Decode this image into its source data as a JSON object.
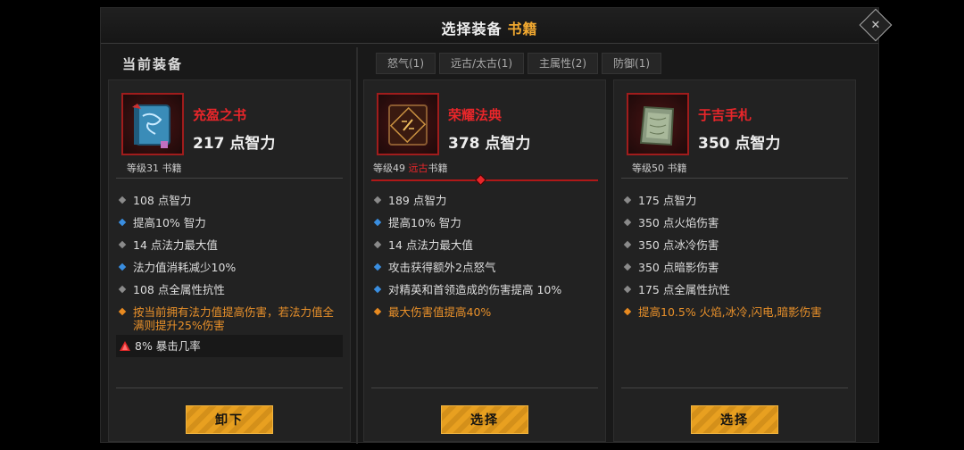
{
  "header": {
    "title": "选择装备",
    "title_accent": "书籍"
  },
  "left_header": "当前装备",
  "tabs": [
    "怒气(1)",
    "远古/太古(1)",
    "主属性(2)",
    "防御(1)"
  ],
  "cards": [
    {
      "name": "充盈之书",
      "main_stat": "217 点智力",
      "meta_prefix": "等级31",
      "meta_rarity": "",
      "meta_suffix": " 书籍",
      "stats": [
        {
          "text": "108 点智力",
          "dot": "grey"
        },
        {
          "text": "提高10% 智力",
          "dot": "blue"
        },
        {
          "text": "14 点法力最大值",
          "dot": "grey"
        },
        {
          "text": "法力值消耗减少10%",
          "dot": "blue"
        },
        {
          "text": "108 点全属性抗性",
          "dot": "grey"
        },
        {
          "text": "按当前拥有法力值提高伤害，若法力值全满则提升25%伤害",
          "dot": "orange"
        }
      ],
      "crit": "8% 暴击几率",
      "button": "卸下"
    },
    {
      "name": "荣耀法典",
      "main_stat": "378 点智力",
      "meta_prefix": "等级49 ",
      "meta_rarity": "远古",
      "meta_suffix": "书籍",
      "stats": [
        {
          "text": "189 点智力",
          "dot": "grey"
        },
        {
          "text": "提高10% 智力",
          "dot": "blue"
        },
        {
          "text": "14 点法力最大值",
          "dot": "grey"
        },
        {
          "text": "攻击获得额外2点怒气",
          "dot": "blue"
        },
        {
          "text": "对精英和首领造成的伤害提高 10%",
          "dot": "blue"
        },
        {
          "text": "最大伤害值提高40%",
          "dot": "orange"
        }
      ],
      "button": "选择"
    },
    {
      "name": "于吉手札",
      "main_stat": "350 点智力",
      "meta_prefix": "等级50",
      "meta_rarity": "",
      "meta_suffix": " 书籍",
      "stats": [
        {
          "text": "175 点智力",
          "dot": "grey"
        },
        {
          "text": "350 点火焰伤害",
          "dot": "grey"
        },
        {
          "text": "350 点冰冷伤害",
          "dot": "grey"
        },
        {
          "text": "350 点暗影伤害",
          "dot": "grey"
        },
        {
          "text": "175 点全属性抗性",
          "dot": "grey"
        },
        {
          "text": "提高10.5% 火焰,冰冷,闪电,暗影伤害",
          "dot": "orange"
        }
      ],
      "button": "选择"
    }
  ],
  "colors": {
    "accent": "#f0a830",
    "item_name": "#e8262a",
    "button": "#e8a020",
    "stat_grey": "#8a8a8a",
    "stat_blue": "#3a8ee0",
    "stat_orange": "#e88a20"
  }
}
